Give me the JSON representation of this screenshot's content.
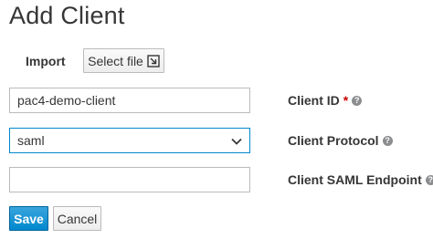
{
  "page": {
    "title": "Add Client"
  },
  "import": {
    "label": "Import",
    "select_file_label": "Select file"
  },
  "form": {
    "client_id": {
      "label": "Client ID",
      "required_mark": "*",
      "value": "pac4-demo-client"
    },
    "client_protocol": {
      "label": "Client Protocol",
      "selected": "saml"
    },
    "client_saml_endpoint": {
      "label": "Client SAML Endpoint",
      "value": ""
    }
  },
  "actions": {
    "save_label": "Save",
    "cancel_label": "Cancel"
  },
  "icons": {
    "help": "help-icon",
    "import": "import-icon",
    "dropdown": "chevron-down-icon"
  },
  "colors": {
    "primary": "#0088ce",
    "required": "#cc0000"
  }
}
